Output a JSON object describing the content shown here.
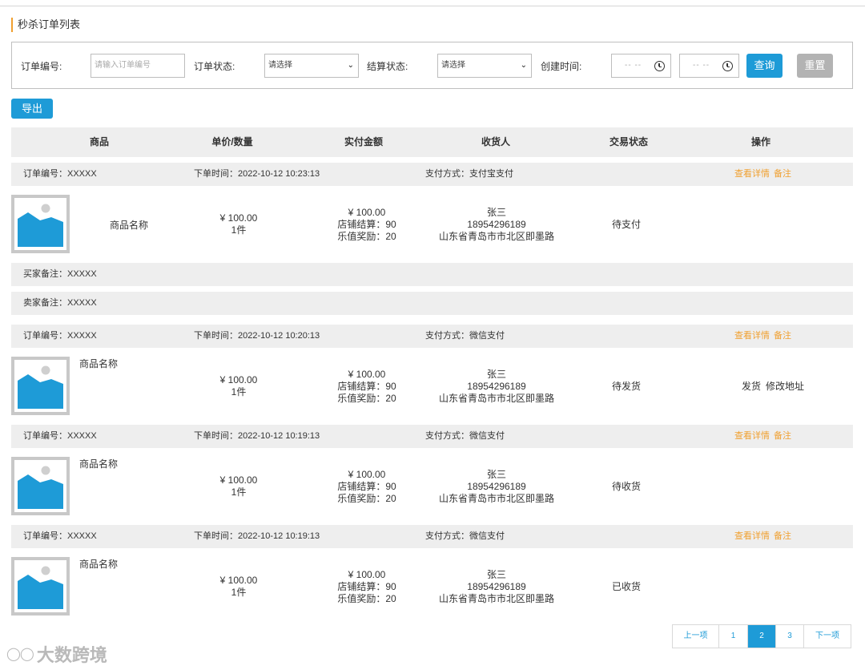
{
  "page_title": "秒杀订单列表",
  "filters": {
    "order_no_label": "订单编号:",
    "order_no_placeholder": "请输入订单编号",
    "order_status_label": "订单状态:",
    "order_status_value": "请选择",
    "settle_status_label": "结算状态:",
    "settle_status_value": "请选择",
    "create_time_label": "创建时间:",
    "time_start_value": "-- --",
    "time_end_value": "-- --",
    "query_label": "查询",
    "reset_label": "重置"
  },
  "export_label": "导出",
  "columns": [
    "商品",
    "单价/数量",
    "实付金额",
    "收货人",
    "交易状态",
    "操作"
  ],
  "orders": [
    {
      "order_no": "订单编号：XXXXX",
      "order_time": "下单时间：2022-10-12 10:23:13",
      "payment": "支付方式：支付宝支付",
      "header_actions": [
        "查看详情",
        "备注"
      ],
      "product_name": "商品名称",
      "price": "¥ 100.00",
      "quantity": "1件",
      "paid": "¥ 100.00",
      "store_settle": "店铺结算：90",
      "reward": "乐值奖励：20",
      "receiver_name": "张三",
      "receiver_phone": "18954296189",
      "receiver_address": "山东省青岛市市北区即墨路",
      "status": "待支付",
      "row_actions": [],
      "buyer_note": "买家备注：XXXXX",
      "seller_note": "卖家备注：XXXXX"
    },
    {
      "order_no": "订单编号：XXXXX",
      "order_time": "下单时间：2022-10-12 10:20:13",
      "payment": "支付方式：微信支付",
      "header_actions": [
        "查看详情",
        "备注"
      ],
      "product_name": "商品名称",
      "price": "¥ 100.00",
      "quantity": "1件",
      "paid": "¥ 100.00",
      "store_settle": "店铺结算：90",
      "reward": "乐值奖励：20",
      "receiver_name": "张三",
      "receiver_phone": "18954296189",
      "receiver_address": "山东省青岛市市北区即墨路",
      "status": "待发货",
      "row_actions": [
        "发货",
        "修改地址"
      ]
    },
    {
      "order_no": "订单编号：XXXXX",
      "order_time": "下单时间：2022-10-12 10:19:13",
      "payment": "支付方式：微信支付",
      "header_actions": [
        "查看详情",
        "备注"
      ],
      "product_name": "商品名称",
      "price": "¥ 100.00",
      "quantity": "1件",
      "paid": "¥ 100.00",
      "store_settle": "店铺结算：90",
      "reward": "乐值奖励：20",
      "receiver_name": "张三",
      "receiver_phone": "18954296189",
      "receiver_address": "山东省青岛市市北区即墨路",
      "status": "待收货",
      "row_actions": []
    },
    {
      "order_no": "订单编号：XXXXX",
      "order_time": "下单时间：2022-10-12 10:19:13",
      "payment": "支付方式：微信支付",
      "header_actions": [
        "查看详情",
        "备注"
      ],
      "product_name": "商品名称",
      "price": "¥ 100.00",
      "quantity": "1件",
      "paid": "¥ 100.00",
      "store_settle": "店铺结算：90",
      "reward": "乐值奖励：20",
      "receiver_name": "张三",
      "receiver_phone": "18954296189",
      "receiver_address": "山东省青岛市市北区即墨路",
      "status": "已收货",
      "row_actions": []
    }
  ],
  "pagination": {
    "prev": "上一项",
    "pages": [
      "1",
      "2",
      "3"
    ],
    "current": "2",
    "next": "下一项"
  },
  "watermark": "大数跨境",
  "colors": {
    "accent_blue": "#1e9bd7",
    "link_orange": "#f0a030",
    "header_gray": "#eeeeee",
    "title_bar_orange": "#f0a030"
  }
}
